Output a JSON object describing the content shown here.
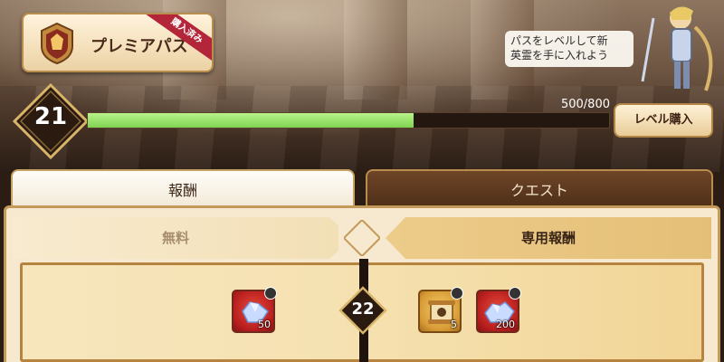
{
  "pass": {
    "title": "プレミアパス",
    "purchased_label": "購入済み"
  },
  "hero": {
    "message_line1": "パスをレベルして新",
    "message_line2": "英霊を手に入れよう"
  },
  "level": {
    "current": "21",
    "progress_text": "500/800",
    "progress_fraction": 0.625,
    "buy_button_label": "レベル購入"
  },
  "tabs": [
    {
      "label": "報酬",
      "active": true
    },
    {
      "label": "クエスト",
      "active": false
    }
  ],
  "columns": {
    "free_label": "無料",
    "premium_label": "専用報酬"
  },
  "reward_rows": [
    {
      "level": "22",
      "free": [
        {
          "icon": "crystal-icon",
          "count": "50"
        }
      ],
      "premium": [
        {
          "icon": "scroll-icon",
          "count": "5"
        },
        {
          "icon": "crystal-icon",
          "count": "200"
        }
      ]
    }
  ],
  "colors": {
    "progress_fill": "#8bdc5c",
    "ribbon": "#b3263a",
    "panel_border": "#c49a5a"
  }
}
